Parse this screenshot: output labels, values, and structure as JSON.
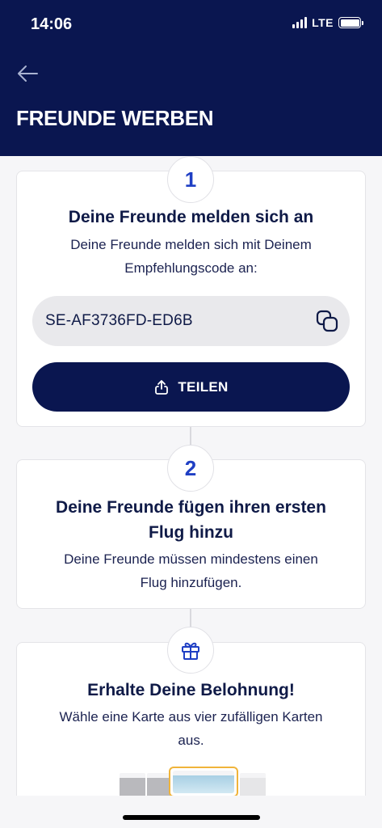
{
  "status_bar": {
    "time": "14:06",
    "network": "LTE"
  },
  "header": {
    "title": "FREUNDE WERBEN"
  },
  "step1": {
    "badge": "1",
    "title": "Deine Freunde melden sich an",
    "desc_line1": "Deine Freunde melden sich mit Deinem",
    "desc_line2": "Empfehlungscode an:",
    "code": "SE-AF3736FD-ED6B",
    "share_label": "TEILEN"
  },
  "step2": {
    "badge": "2",
    "title_line1": "Deine Freunde fügen ihren ersten",
    "title_line2": "Flug hinzu",
    "desc_line1": "Deine Freunde müssen mindestens einen",
    "desc_line2": "Flug hinzufügen."
  },
  "step3": {
    "badge_icon": "gift-icon",
    "title": "Erhalte Deine Belohnung!",
    "desc_line1": "Wähle eine Karte aus vier zufälligen Karten",
    "desc_line2": "aus."
  },
  "colors": {
    "header_bg": "#0a1650",
    "accent": "#1f3fc4",
    "button_bg": "#0a1650",
    "highlight_border": "#f0b43a"
  }
}
